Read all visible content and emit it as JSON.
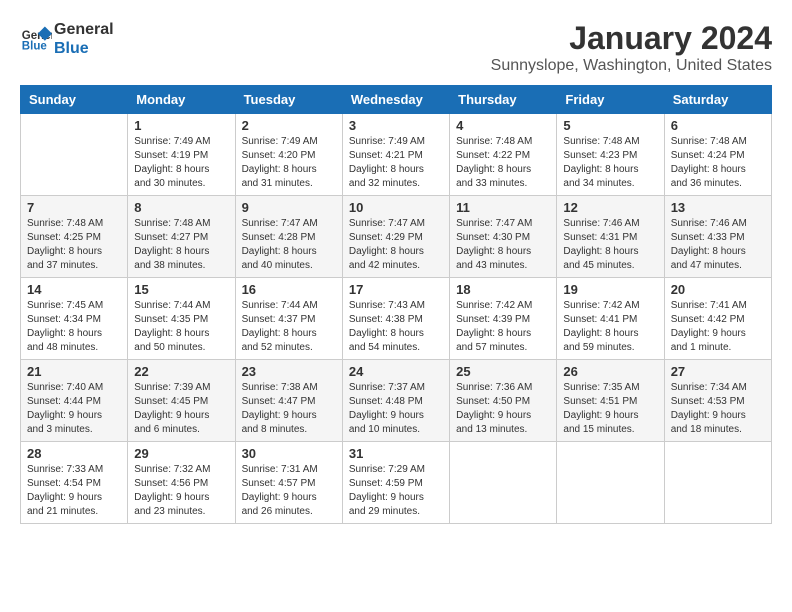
{
  "header": {
    "logo_line1": "General",
    "logo_line2": "Blue",
    "title": "January 2024",
    "subtitle": "Sunnyslope, Washington, United States"
  },
  "weekdays": [
    "Sunday",
    "Monday",
    "Tuesday",
    "Wednesday",
    "Thursday",
    "Friday",
    "Saturday"
  ],
  "weeks": [
    [
      {
        "day": "",
        "info": ""
      },
      {
        "day": "1",
        "info": "Sunrise: 7:49 AM\nSunset: 4:19 PM\nDaylight: 8 hours\nand 30 minutes."
      },
      {
        "day": "2",
        "info": "Sunrise: 7:49 AM\nSunset: 4:20 PM\nDaylight: 8 hours\nand 31 minutes."
      },
      {
        "day": "3",
        "info": "Sunrise: 7:49 AM\nSunset: 4:21 PM\nDaylight: 8 hours\nand 32 minutes."
      },
      {
        "day": "4",
        "info": "Sunrise: 7:48 AM\nSunset: 4:22 PM\nDaylight: 8 hours\nand 33 minutes."
      },
      {
        "day": "5",
        "info": "Sunrise: 7:48 AM\nSunset: 4:23 PM\nDaylight: 8 hours\nand 34 minutes."
      },
      {
        "day": "6",
        "info": "Sunrise: 7:48 AM\nSunset: 4:24 PM\nDaylight: 8 hours\nand 36 minutes."
      }
    ],
    [
      {
        "day": "7",
        "info": "Sunrise: 7:48 AM\nSunset: 4:25 PM\nDaylight: 8 hours\nand 37 minutes."
      },
      {
        "day": "8",
        "info": "Sunrise: 7:48 AM\nSunset: 4:27 PM\nDaylight: 8 hours\nand 38 minutes."
      },
      {
        "day": "9",
        "info": "Sunrise: 7:47 AM\nSunset: 4:28 PM\nDaylight: 8 hours\nand 40 minutes."
      },
      {
        "day": "10",
        "info": "Sunrise: 7:47 AM\nSunset: 4:29 PM\nDaylight: 8 hours\nand 42 minutes."
      },
      {
        "day": "11",
        "info": "Sunrise: 7:47 AM\nSunset: 4:30 PM\nDaylight: 8 hours\nand 43 minutes."
      },
      {
        "day": "12",
        "info": "Sunrise: 7:46 AM\nSunset: 4:31 PM\nDaylight: 8 hours\nand 45 minutes."
      },
      {
        "day": "13",
        "info": "Sunrise: 7:46 AM\nSunset: 4:33 PM\nDaylight: 8 hours\nand 47 minutes."
      }
    ],
    [
      {
        "day": "14",
        "info": "Sunrise: 7:45 AM\nSunset: 4:34 PM\nDaylight: 8 hours\nand 48 minutes."
      },
      {
        "day": "15",
        "info": "Sunrise: 7:44 AM\nSunset: 4:35 PM\nDaylight: 8 hours\nand 50 minutes."
      },
      {
        "day": "16",
        "info": "Sunrise: 7:44 AM\nSunset: 4:37 PM\nDaylight: 8 hours\nand 52 minutes."
      },
      {
        "day": "17",
        "info": "Sunrise: 7:43 AM\nSunset: 4:38 PM\nDaylight: 8 hours\nand 54 minutes."
      },
      {
        "day": "18",
        "info": "Sunrise: 7:42 AM\nSunset: 4:39 PM\nDaylight: 8 hours\nand 57 minutes."
      },
      {
        "day": "19",
        "info": "Sunrise: 7:42 AM\nSunset: 4:41 PM\nDaylight: 8 hours\nand 59 minutes."
      },
      {
        "day": "20",
        "info": "Sunrise: 7:41 AM\nSunset: 4:42 PM\nDaylight: 9 hours\nand 1 minute."
      }
    ],
    [
      {
        "day": "21",
        "info": "Sunrise: 7:40 AM\nSunset: 4:44 PM\nDaylight: 9 hours\nand 3 minutes."
      },
      {
        "day": "22",
        "info": "Sunrise: 7:39 AM\nSunset: 4:45 PM\nDaylight: 9 hours\nand 6 minutes."
      },
      {
        "day": "23",
        "info": "Sunrise: 7:38 AM\nSunset: 4:47 PM\nDaylight: 9 hours\nand 8 minutes."
      },
      {
        "day": "24",
        "info": "Sunrise: 7:37 AM\nSunset: 4:48 PM\nDaylight: 9 hours\nand 10 minutes."
      },
      {
        "day": "25",
        "info": "Sunrise: 7:36 AM\nSunset: 4:50 PM\nDaylight: 9 hours\nand 13 minutes."
      },
      {
        "day": "26",
        "info": "Sunrise: 7:35 AM\nSunset: 4:51 PM\nDaylight: 9 hours\nand 15 minutes."
      },
      {
        "day": "27",
        "info": "Sunrise: 7:34 AM\nSunset: 4:53 PM\nDaylight: 9 hours\nand 18 minutes."
      }
    ],
    [
      {
        "day": "28",
        "info": "Sunrise: 7:33 AM\nSunset: 4:54 PM\nDaylight: 9 hours\nand 21 minutes."
      },
      {
        "day": "29",
        "info": "Sunrise: 7:32 AM\nSunset: 4:56 PM\nDaylight: 9 hours\nand 23 minutes."
      },
      {
        "day": "30",
        "info": "Sunrise: 7:31 AM\nSunset: 4:57 PM\nDaylight: 9 hours\nand 26 minutes."
      },
      {
        "day": "31",
        "info": "Sunrise: 7:29 AM\nSunset: 4:59 PM\nDaylight: 9 hours\nand 29 minutes."
      },
      {
        "day": "",
        "info": ""
      },
      {
        "day": "",
        "info": ""
      },
      {
        "day": "",
        "info": ""
      }
    ]
  ]
}
